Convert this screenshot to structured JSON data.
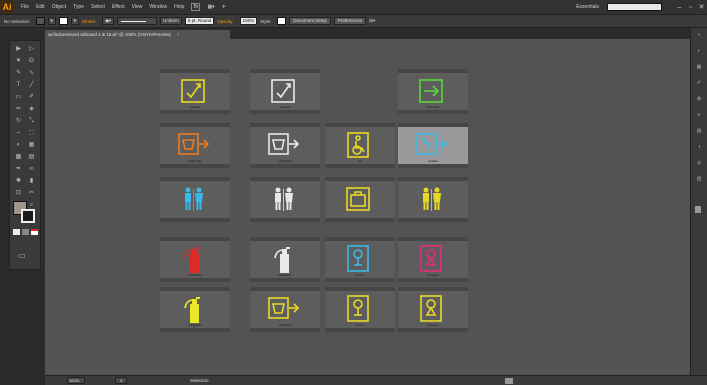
{
  "app": {
    "logo": "Ai",
    "menus": [
      "File",
      "Edit",
      "Object",
      "Type",
      "Select",
      "Effect",
      "View",
      "Window",
      "Help"
    ],
    "workspace_label": "Essentials",
    "window_buttons": [
      "–",
      "▫",
      "✕"
    ]
  },
  "control_bar": {
    "selection_label": "No Selection",
    "stroke_label": "Stroke:",
    "stroke_profile": "Uniform",
    "brush": "5 pt. Round",
    "opacity_label": "Opacity:",
    "opacity_value": "100%",
    "style_label": "Style:",
    "doc_setup_button": "Document Setup",
    "preferences_button": "Preferences",
    "fill_color": "#ffffff",
    "accent_color": "#ff9a00"
  },
  "document": {
    "tab_title": "wcfisdunmiserd artboard 1 & 15.ai* @ 100% (CMYK/Preview)",
    "close_glyph": "×"
  },
  "tools": {
    "icons": [
      "selection-tool",
      "direct-selection-tool",
      "magic-wand-tool",
      "lasso-tool",
      "pen-tool",
      "curvature-tool",
      "type-tool",
      "line-tool",
      "rectangle-tool",
      "paintbrush-tool",
      "pencil-tool",
      "eraser-tool",
      "rotate-tool",
      "scale-tool",
      "width-tool",
      "free-transform-tool",
      "shape-builder-tool",
      "perspective-tool",
      "mesh-tool",
      "gradient-tool",
      "eyedropper-tool",
      "blend-tool",
      "symbol-sprayer-tool",
      "graph-tool",
      "artboard-tool",
      "slice-tool",
      "hand-tool",
      "zoom-tool"
    ],
    "glyphs": [
      "▶",
      "▷",
      "✷",
      "ʘ",
      "✎",
      "∿",
      "T",
      "╱",
      "▭",
      "✐",
      "✏",
      "◈",
      "↻",
      "⤡",
      "⇔",
      "⬚",
      "◐",
      "▦",
      "▩",
      "▤",
      "✒",
      "∞",
      "✺",
      "▮",
      "⊡",
      "✂",
      "✋",
      "⌕"
    ],
    "fill_color": "#a2958a",
    "stroke_color": "#1a1a1a",
    "screen_mode_glyph": "▭"
  },
  "artboards": {
    "highlight_color": "#9a9a9a",
    "items": [
      {
        "col": 0,
        "row": 0,
        "icon": "checkbox-arrow-up-icon",
        "color": "#e8d826",
        "caption": "elevator"
      },
      {
        "col": 1,
        "row": 0,
        "icon": "checkbox-arrow-up-icon",
        "color": "#e8e8e8",
        "caption": "elevator"
      },
      {
        "col": 3,
        "row": 0,
        "icon": "exit-arrow-icon",
        "color": "#5bd63c",
        "caption": "exit & office"
      },
      {
        "col": 0,
        "row": 1,
        "icon": "cup-arrow-icon",
        "color": "#f07a1c",
        "caption": "coffee shop"
      },
      {
        "col": 1,
        "row": 1,
        "icon": "cup-arrow-icon",
        "color": "#e8e8e8",
        "caption": "coffee shop"
      },
      {
        "col": 2,
        "row": 1,
        "icon": "wheelchair-icon",
        "color": "#e8d826",
        "caption": "wc"
      },
      {
        "col": 3,
        "row": 1,
        "icon": "stairs-arrow-icon",
        "color": "#3ab8e8",
        "caption": "escalator",
        "selected": true
      },
      {
        "col": 0,
        "row": 2,
        "icon": "restroom-people-icon",
        "color": "#3ab8e8",
        "caption": ""
      },
      {
        "col": 1,
        "row": 2,
        "icon": "restroom-people-icon",
        "color": "#e8e8e8",
        "caption": ""
      },
      {
        "col": 2,
        "row": 2,
        "icon": "briefcase-icon",
        "color": "#e8d826",
        "caption": ""
      },
      {
        "col": 3,
        "row": 2,
        "icon": "restroom-people-icon",
        "color": "#e8d826",
        "caption": ""
      },
      {
        "col": 0,
        "row": 3,
        "icon": "fire-extinguisher-icon",
        "color": "#e02a2a",
        "caption": "extinguisher"
      },
      {
        "col": 1,
        "row": 3,
        "icon": "fire-extinguisher-icon",
        "color": "#e8e8e8",
        "caption": "extinguisher"
      },
      {
        "col": 2,
        "row": 3,
        "icon": "male-toilet-icon",
        "color": "#3ab8e8",
        "caption": "wc men"
      },
      {
        "col": 3,
        "row": 3,
        "icon": "female-toilet-icon",
        "color": "#e8287a",
        "caption": "wc women"
      },
      {
        "col": 0,
        "row": 4,
        "icon": "fire-extinguisher-icon",
        "color": "#e8e826",
        "caption": "extinguisher"
      },
      {
        "col": 1,
        "row": 4,
        "icon": "cup-arrow-icon",
        "color": "#e8d826",
        "caption": "coffee shop"
      },
      {
        "col": 2,
        "row": 4,
        "icon": "male-toilet-icon",
        "color": "#e8d826",
        "caption": "wc men"
      },
      {
        "col": 3,
        "row": 4,
        "icon": "female-toilet-icon",
        "color": "#e8d826",
        "caption": "wc women"
      }
    ]
  },
  "status_bar": {
    "zoom": "100%",
    "page": "4",
    "status_text": "Selection"
  }
}
